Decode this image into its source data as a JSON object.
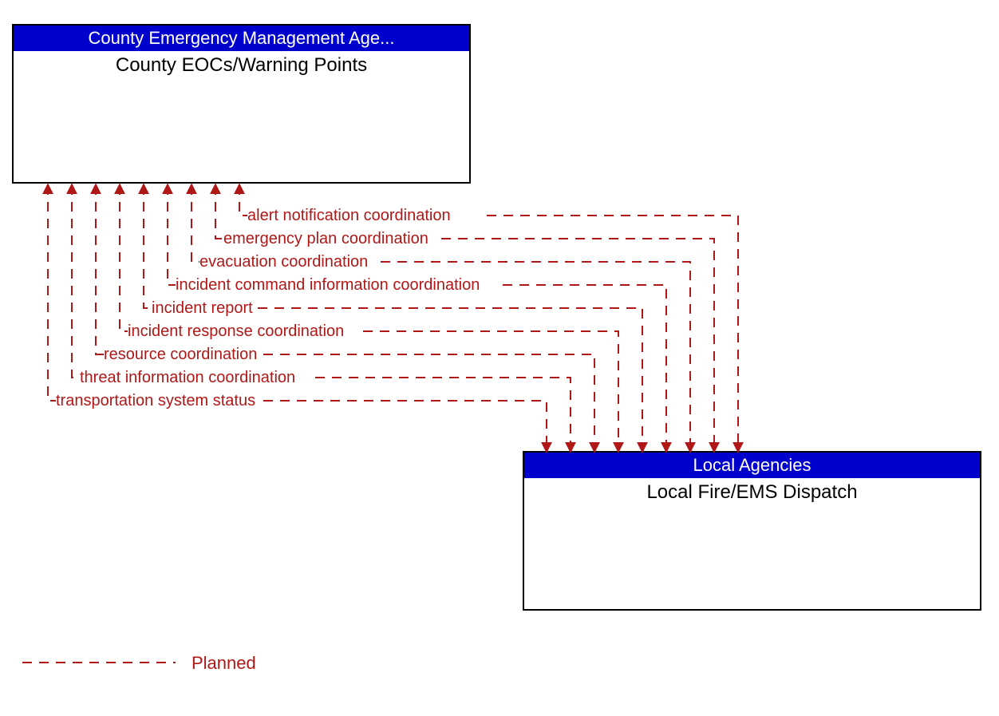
{
  "boxes": {
    "top": {
      "header": "County Emergency Management Age...",
      "body": "County EOCs/Warning Points"
    },
    "bottom": {
      "header": "Local Agencies",
      "body": "Local Fire/EMS Dispatch"
    }
  },
  "flows": [
    "alert notification coordination",
    "emergency plan coordination",
    "evacuation coordination",
    "incident command information coordination",
    "incident report",
    "incident response coordination",
    "resource coordination",
    "threat information coordination",
    "transportation system status"
  ],
  "legend": {
    "planned": "Planned"
  },
  "colors": {
    "flow": "#b01818",
    "header_bg": "#0000cc",
    "header_fg": "#ffffff"
  }
}
